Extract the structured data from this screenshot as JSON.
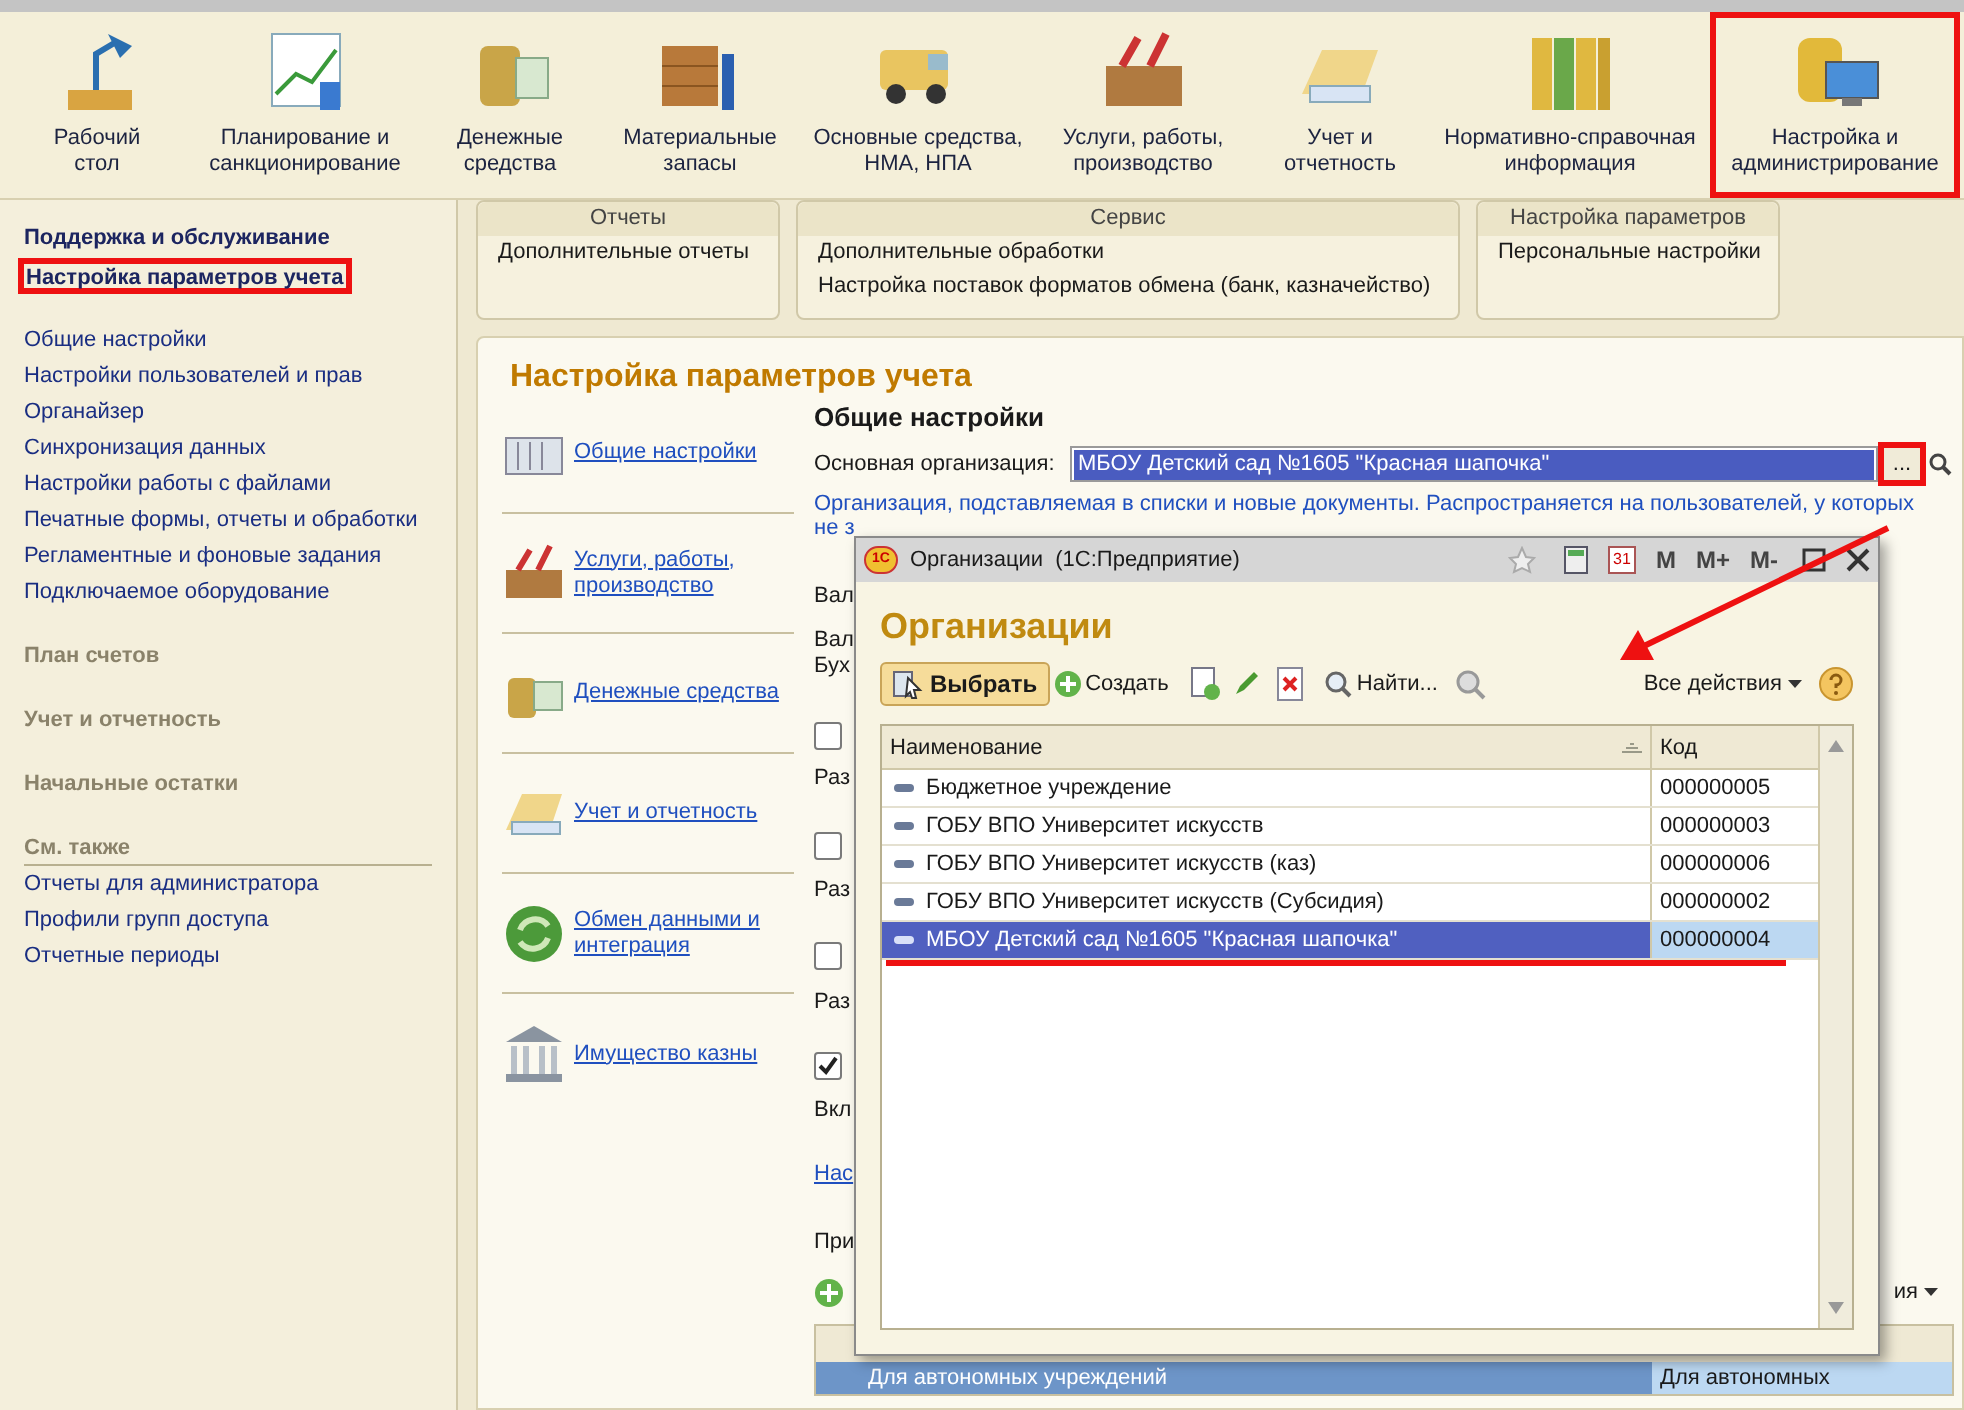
{
  "sections": [
    {
      "lines": [
        "Рабочий",
        "стол"
      ],
      "marked": false
    },
    {
      "lines": [
        "Планирование и",
        "санкционирование"
      ],
      "marked": false
    },
    {
      "lines": [
        "Денежные",
        "средства"
      ],
      "marked": false
    },
    {
      "lines": [
        "Материальные",
        "запасы"
      ],
      "marked": false
    },
    {
      "lines": [
        "Основные средства,",
        "НМА, НПА"
      ],
      "marked": false
    },
    {
      "lines": [
        "Услуги, работы,",
        "производство"
      ],
      "marked": false
    },
    {
      "lines": [
        "Учет и",
        "отчетность"
      ],
      "marked": false
    },
    {
      "lines": [
        "Нормативно-справочная",
        "информация"
      ],
      "marked": false
    },
    {
      "lines": [
        "Настройка и",
        "администрирование"
      ],
      "marked": true
    }
  ],
  "sidebar": [
    {
      "kind": "section",
      "text": "Поддержка и обслуживание",
      "marked": false
    },
    {
      "kind": "section",
      "text": "Настройка параметров учета",
      "marked": true
    },
    {
      "kind": "link",
      "text": "Общие настройки"
    },
    {
      "kind": "link",
      "text": "Настройки пользователей и прав"
    },
    {
      "kind": "link",
      "text": "Органайзер"
    },
    {
      "kind": "link",
      "text": "Синхронизация данных"
    },
    {
      "kind": "link",
      "text": "Настройки работы с файлами"
    },
    {
      "kind": "link",
      "text": "Печатные формы, отчеты и обработки"
    },
    {
      "kind": "link",
      "text": "Регламентные и фоновые задания"
    },
    {
      "kind": "link",
      "text": "Подключаемое оборудование"
    },
    {
      "kind": "group",
      "text": "План счетов"
    },
    {
      "kind": "group",
      "text": "Учет и отчетность"
    },
    {
      "kind": "group",
      "text": "Начальные остатки"
    },
    {
      "kind": "subheader",
      "text": "См. также"
    },
    {
      "kind": "link",
      "text": "Отчеты для администратора"
    },
    {
      "kind": "link",
      "text": "Профили групп доступа"
    },
    {
      "kind": "link",
      "text": "Отчетные периоды"
    }
  ],
  "command_groups": [
    {
      "title": "Отчеты",
      "items": [
        "Дополнительные отчеты"
      ]
    },
    {
      "title": "Сервис",
      "items": [
        "Дополнительные обработки",
        "Настройка поставок форматов обмена (банк, казначейство)"
      ]
    },
    {
      "title": "Настройка параметров",
      "items": [
        "Персональные настройки"
      ]
    }
  ],
  "content": {
    "title": "Настройка параметров учета",
    "nav": [
      {
        "lines": [
          "Общие настройки"
        ]
      },
      {
        "lines": [
          "Услуги, работы,",
          "производство"
        ]
      },
      {
        "lines": [
          "Денежные средства"
        ]
      },
      {
        "lines": [
          "Учет и отчетность"
        ]
      },
      {
        "lines": [
          "Обмен данными и",
          "интеграция"
        ]
      },
      {
        "lines": [
          "Имущество казны"
        ]
      }
    ],
    "heading": "Общие настройки",
    "field": {
      "label": "Основная организация:",
      "value": "МБОУ Детский сад №1605 \"Красная шапочка\"",
      "select_button": "...",
      "marked": true
    },
    "description": "Организация, подставляемая в списки и новые документы. Распространяется на пользователей, у которых",
    "description_cut": "не з",
    "fragments": [
      {
        "kind": "text",
        "text": "Вал"
      },
      {
        "kind": "text",
        "text": "Вал"
      },
      {
        "kind": "text",
        "text": "Бух"
      },
      {
        "kind": "checkbox",
        "checked": false
      },
      {
        "kind": "text",
        "text": "Раз"
      },
      {
        "kind": "checkbox",
        "checked": false
      },
      {
        "kind": "text",
        "text": "Раз"
      },
      {
        "kind": "checkbox",
        "checked": false
      },
      {
        "kind": "text",
        "text": "Раз"
      },
      {
        "kind": "checkbox",
        "checked": true
      },
      {
        "kind": "text",
        "text": "Вкл"
      },
      {
        "kind": "link",
        "text": "Нас"
      },
      {
        "kind": "text",
        "text": "При"
      }
    ],
    "list_actions": "ия",
    "list_rows": [
      {
        "cells": [
          "Для автономных учреждений",
          "Для автономных"
        ],
        "selected": true
      }
    ]
  },
  "dialog": {
    "title": "Организации  (1С:Предприятие)",
    "logo": "1С",
    "calendar_day": "31",
    "memory_buttons": [
      "M",
      "M+",
      "M-"
    ],
    "heading": "Организации",
    "toolbar": [
      {
        "kind": "choose",
        "label": "Выбрать"
      },
      {
        "kind": "create",
        "label": "Создать"
      },
      {
        "kind": "copy"
      },
      {
        "kind": "edit"
      },
      {
        "kind": "delete"
      },
      {
        "kind": "find",
        "label": "Найти..."
      },
      {
        "kind": "cancel-find"
      }
    ],
    "all_actions": "Все действия",
    "columns": [
      "Наименование",
      "Код"
    ],
    "rows": [
      {
        "name": "Бюджетное учреждение",
        "code": "000000005",
        "selected": false,
        "underlined": false
      },
      {
        "name": "ГОБУ ВПО Университет искусств",
        "code": "000000003",
        "selected": false,
        "underlined": false
      },
      {
        "name": "ГОБУ ВПО Университет искусств (каз)",
        "code": "000000006",
        "selected": false,
        "underlined": false
      },
      {
        "name": "ГОБУ ВПО Университет искусств (Субсидия)",
        "code": "000000002",
        "selected": false,
        "underlined": false
      },
      {
        "name": "МБОУ Детский сад №1605 \"Красная шапочка\"",
        "code": "000000004",
        "selected": true,
        "underlined": true
      }
    ]
  },
  "annotations": [
    {
      "kind": "arrow"
    }
  ]
}
